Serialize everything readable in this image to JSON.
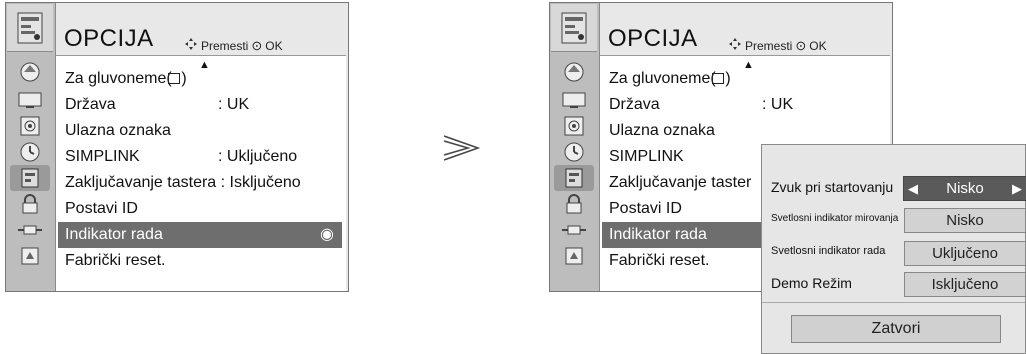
{
  "left_menu": {
    "title": "OPCIJA",
    "hint_move": "Premesti",
    "hint_ok": "OK",
    "rows": [
      {
        "label": "Za gluvoneme(   )",
        "value": ""
      },
      {
        "label": "Država",
        "value": ": UK"
      },
      {
        "label": "Ulazna oznaka",
        "value": ""
      },
      {
        "label": "SIMPLINK",
        "value": ": Uključeno"
      },
      {
        "label": "Zaključavanje tastera  : Isključeno",
        "value": ""
      },
      {
        "label": "Postavi ID",
        "value": ""
      },
      {
        "label": "Indikator rada",
        "value": ""
      },
      {
        "label": "Fabrički reset.",
        "value": ""
      }
    ]
  },
  "right_menu": {
    "title": "OPCIJA",
    "hint_move": "Premesti",
    "hint_ok": "OK",
    "rows": [
      {
        "label": "Za gluvoneme(   )",
        "value": ""
      },
      {
        "label": "Država",
        "value": ": UK"
      },
      {
        "label": "Ulazna oznaka",
        "value": ""
      },
      {
        "label": "SIMPLINK",
        "value": ""
      },
      {
        "label": "Zaključavanje taster",
        "value": ""
      },
      {
        "label": "Postavi ID",
        "value": ""
      },
      {
        "label": "Indikator rada",
        "value": ""
      },
      {
        "label": "Fabrički reset.",
        "value": ""
      }
    ]
  },
  "popup": {
    "rows": [
      {
        "label": "Zvuk pri startovanju",
        "value": "Nisko"
      },
      {
        "label": "Svetlosni indikator mirovanja",
        "value": "Nisko"
      },
      {
        "label": "Svetlosni indikator rada",
        "value": "Uključeno"
      },
      {
        "label": "Demo Režim",
        "value": "Isključeno"
      }
    ],
    "close_label": "Zatvori"
  },
  "icons": [
    "picture-icon",
    "screen-icon",
    "audio-icon",
    "time-icon",
    "option-icon",
    "lock-icon",
    "input-icon",
    "usb-icon"
  ]
}
